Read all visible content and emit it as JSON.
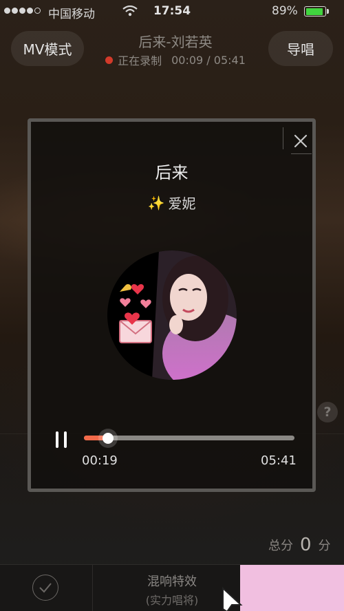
{
  "status_bar": {
    "carrier": "中国移动",
    "time": "17:54",
    "battery_percent": "89%",
    "battery_level": 0.89
  },
  "header": {
    "mv_button": "MV模式",
    "song_title": "后来-刘若英",
    "recording_status": "正在录制",
    "recording_time": "00:09 / 05:41",
    "guide_button": "导唱"
  },
  "dialog": {
    "title": "后来",
    "singer": "爱妮",
    "singer_emoji": "✨",
    "player": {
      "elapsed": "00:19",
      "total": "05:41",
      "progress": 0.055
    }
  },
  "score": {
    "label": "总分",
    "value": "0",
    "unit": "分"
  },
  "bottom_bar": {
    "effect_label": "混响特效",
    "effect_sub": "(实力唱将)"
  },
  "colors": {
    "accent": "#f26a4a",
    "recording_dot": "#d23a2a",
    "battery": "#41d53f",
    "pink_block": "#f1bfe0"
  },
  "icons": [
    "wifi-icon",
    "battery-icon",
    "recording-dot-icon",
    "close-icon",
    "sparkle-icon",
    "pause-icon",
    "help-icon",
    "checkmark-icon",
    "cursor-icon"
  ]
}
